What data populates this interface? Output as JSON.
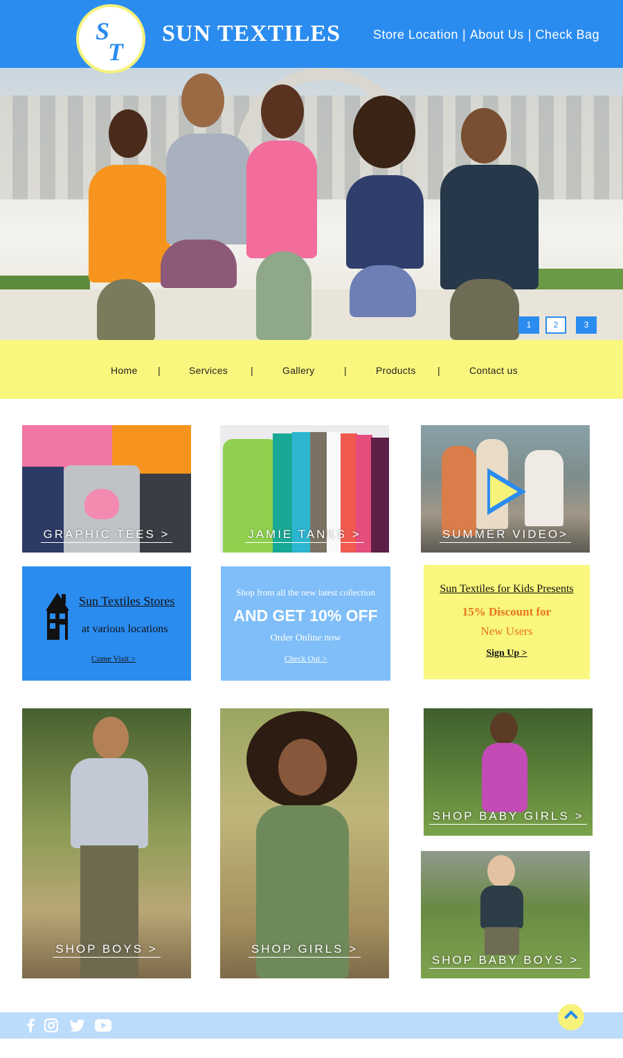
{
  "header": {
    "logo_s": "S",
    "logo_t": "T",
    "brand": "SUN TEXTILES",
    "links": [
      "Store Location",
      "About  Us",
      "Check Bag"
    ],
    "separator": "|"
  },
  "hero": {
    "slides": [
      "1",
      "2",
      "3"
    ],
    "active_slide": "2"
  },
  "nav": {
    "items": [
      "Home",
      "Services",
      "Gallery",
      "Products",
      "Contact us"
    ],
    "separator": "|"
  },
  "tiles": {
    "graphic_tees": "GRAPHIC TEES >",
    "jamie_tanks": "JAMIE TANKS >",
    "summer_video": "SUMMER VIDEO>"
  },
  "promos": {
    "stores": {
      "title": "Sun Textiles Stores",
      "subtitle": "at various locations",
      "link": "Come Visit >"
    },
    "sale": {
      "line1": "Shop from all the new latest collection",
      "headline": "AND GET 10% OFF",
      "line2": "Order Online now",
      "link": "Check Out >"
    },
    "kids": {
      "title": "Sun Textiles for Kids Presents",
      "offer_line1": "15% Discount for",
      "offer_line2": "New Users",
      "link": "Sign Up >"
    }
  },
  "shop": {
    "boys": "SHOP BOYS >",
    "girls": "SHOP GIRLS >",
    "baby_girls": "SHOP BABY GIRLS >",
    "baby_boys": "SHOP BABY BOYS >"
  },
  "footer": {
    "icons": [
      "facebook-icon",
      "instagram-icon",
      "twitter-icon",
      "youtube-icon"
    ]
  },
  "colors": {
    "brand_blue": "#2b8cf0",
    "brand_yellow": "#f9f77d",
    "light_blue": "#7fbef8",
    "footer_blue": "#bcdcfb"
  }
}
